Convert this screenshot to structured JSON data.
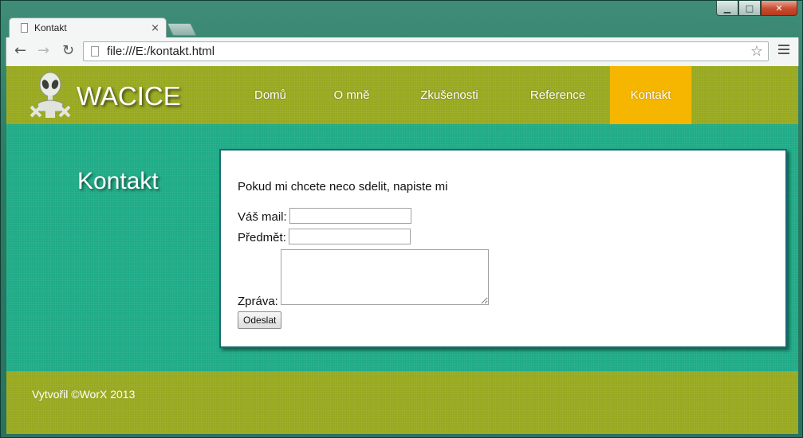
{
  "browser": {
    "tab_title": "Kontakt",
    "tab_close": "×",
    "url": "file:///E:/kontakt.html",
    "window_controls": {
      "minimize": "▁",
      "maximize": "□",
      "close": "✕"
    }
  },
  "site": {
    "logo_text": "WACICE",
    "nav": [
      {
        "label": "Domů",
        "active": false
      },
      {
        "label": "O mně",
        "active": false
      },
      {
        "label": "Zkušenosti",
        "active": false
      },
      {
        "label": "Reference",
        "active": false
      },
      {
        "label": "Kontakt",
        "active": true
      }
    ],
    "page_title": "Kontakt",
    "intro": "Pokud mi chcete neco sdelit, napiste mi",
    "form": {
      "mail_label": "Váš mail:",
      "subject_label": "Předmět:",
      "message_label": "Zpráva:",
      "mail_value": "",
      "subject_value": "",
      "message_value": "",
      "submit_label": "Odeslat"
    },
    "footer": "Vytvořil ©WorX 2013"
  },
  "colors": {
    "header_bg": "#98a81f",
    "content_bg": "#1fab87",
    "nav_active": "#f6b600",
    "panel_border": "#1a6a75"
  },
  "icons": {
    "back": "arrow-left-icon",
    "forward": "arrow-right-icon",
    "reload": "reload-icon",
    "bookmark": "star-icon",
    "menu": "hamburger-menu-icon",
    "logo": "alien-logo-icon"
  }
}
